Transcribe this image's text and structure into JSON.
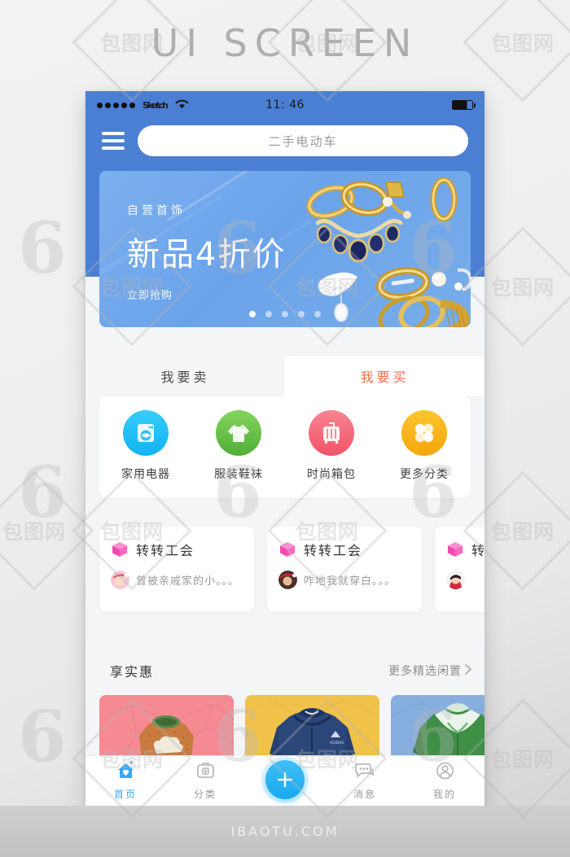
{
  "page": {
    "title": "UI SCREEN",
    "footer": "IBAOTU.COM",
    "watermark_six": "6",
    "watermark_stamp": "包图网"
  },
  "colors": {
    "header_blue": "#4a7fd4",
    "banner_blue": "#6ba3ea",
    "accent_orange": "#fb6a4a",
    "accent_blue": "#35a9f4",
    "fab_blue": "#19a8ef",
    "page_bg": "#f4f5f7"
  },
  "statusbar": {
    "carrier": "Sketch",
    "time": "11: 46",
    "signal_dots": 5,
    "wifi_icon": "wifi-icon",
    "battery_icon": "battery-icon"
  },
  "header": {
    "menu_icon": "hamburger-menu-icon",
    "search": {
      "placeholder": "二手电动车",
      "value": ""
    }
  },
  "banner": {
    "eyebrow": "自营首饰",
    "title": "新品4折价",
    "cta": "立即抢购",
    "dots_total": 5,
    "dots_active_index": 0
  },
  "tabs": [
    {
      "label": "我要卖",
      "active": false
    },
    {
      "label": "我要买",
      "active": true
    }
  ],
  "categories": [
    {
      "label": "家用电器",
      "icon": "washing-machine-icon",
      "color": "#24bcf5"
    },
    {
      "label": "服装鞋袜",
      "icon": "tshirt-icon",
      "color": "#62bd48"
    },
    {
      "label": "时尚箱包",
      "icon": "suitcase-icon",
      "color": "#f4697d"
    },
    {
      "label": "更多分类",
      "icon": "grid-more-icon",
      "color": "#f9b712"
    }
  ],
  "union_cards": [
    {
      "title": "转转工会",
      "desc": "曾被亲戚家的小。。。",
      "badge_icon": "pink-cube-icon",
      "avatar": "avatar-santa-girl"
    },
    {
      "title": "转转工会",
      "desc": "咋地我就穿白。。。",
      "badge_icon": "pink-cube-icon",
      "avatar": "avatar-santa-woman"
    },
    {
      "title": "转",
      "desc": "",
      "badge_icon": "pink-cube-icon",
      "avatar": "avatar-santa-lady"
    }
  ],
  "deals": {
    "title": "享实惠",
    "more_label": "更多精选闲置",
    "more_icon": "chevron-right-icon",
    "items": [
      {
        "name": "orange-cloud-sweater",
        "bg": "#f58a93",
        "garment": "#c97b3f"
      },
      {
        "name": "navy-hoodie",
        "bg": "#f0c24a",
        "garment": "#2b4678"
      },
      {
        "name": "green-jacket",
        "bg": "#86aede",
        "garment": "#3f8f46"
      }
    ]
  },
  "bottom_nav": [
    {
      "label": "首页",
      "icon": "home-heart-icon",
      "active": true
    },
    {
      "label": "分类",
      "icon": "category-box-icon",
      "active": false
    },
    {
      "label": "",
      "icon": "plus-fab-icon",
      "active": false,
      "is_fab": true
    },
    {
      "label": "消息",
      "icon": "chat-bubble-icon",
      "active": false
    },
    {
      "label": "我的",
      "icon": "user-profile-icon",
      "active": false
    }
  ]
}
